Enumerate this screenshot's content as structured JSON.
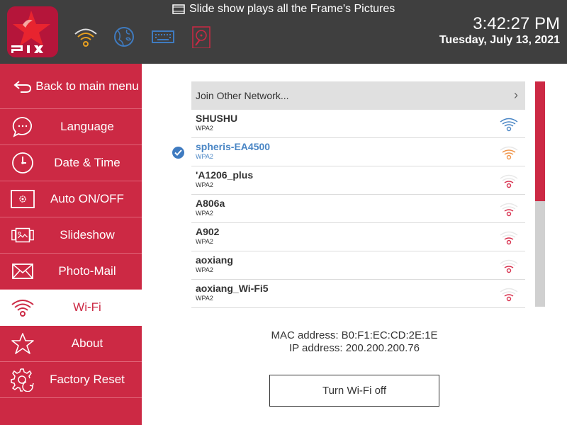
{
  "header": {
    "logo_text": "PIX",
    "notice": "Slide show plays  all the Frame's Pictures",
    "time": "3:42:27 PM",
    "date": "Tuesday, July 13, 2021",
    "status_icons": [
      {
        "name": "wifi-status-icon",
        "color": "#e8a020"
      },
      {
        "name": "globe-icon",
        "color": "#3f7bc0"
      },
      {
        "name": "keyboard-icon",
        "color": "#3f7bc0"
      },
      {
        "name": "storage-drive-icon",
        "color": "#cc2944"
      }
    ]
  },
  "sidebar": {
    "items": [
      {
        "label": "Back to main menu",
        "icon": "back-arrow-icon"
      },
      {
        "label": "Language",
        "icon": "chat-bubble-icon"
      },
      {
        "label": "Date & Time",
        "icon": "clock-icon"
      },
      {
        "label": "Auto ON/OFF",
        "icon": "screen-gear-icon"
      },
      {
        "label": "Slideshow",
        "icon": "slideshow-icon"
      },
      {
        "label": "Photo-Mail",
        "icon": "envelope-icon"
      },
      {
        "label": "Wi-Fi",
        "icon": "wifi-icon",
        "active": true
      },
      {
        "label": "About",
        "icon": "star-icon"
      },
      {
        "label": "Factory Reset",
        "icon": "gear-reset-icon"
      }
    ]
  },
  "wifi": {
    "join_other": "Join Other Network...",
    "networks": [
      {
        "name": "SHUSHU",
        "security": "WPA2",
        "signal_bars": 3,
        "connected": false
      },
      {
        "name": "spheris-EA4500",
        "security": "WPA2",
        "signal_bars": 2,
        "connected": true
      },
      {
        "name": "'A1206_plus",
        "security": "WPA2",
        "signal_bars": 1,
        "connected": false
      },
      {
        "name": "A806a",
        "security": "WPA2",
        "signal_bars": 1,
        "connected": false
      },
      {
        "name": "A902",
        "security": "WPA2",
        "signal_bars": 1,
        "connected": false
      },
      {
        "name": "aoxiang",
        "security": "WPA2",
        "signal_bars": 1,
        "connected": false
      },
      {
        "name": "aoxiang_Wi-Fi5",
        "security": "WPA2",
        "signal_bars": 1,
        "connected": false
      }
    ],
    "scroll_fraction_visible": 0.53,
    "mac_address": "MAC address: B0:F1:EC:CD:2E:1E",
    "ip_address": "IP address: 200.200.200.76",
    "turn_off_label": "Turn Wi-Fi off"
  },
  "colors": {
    "brand_red": "#cc2944",
    "strong": "#4a86c5",
    "medium": "#f0954a",
    "weak": "#d8324f"
  }
}
